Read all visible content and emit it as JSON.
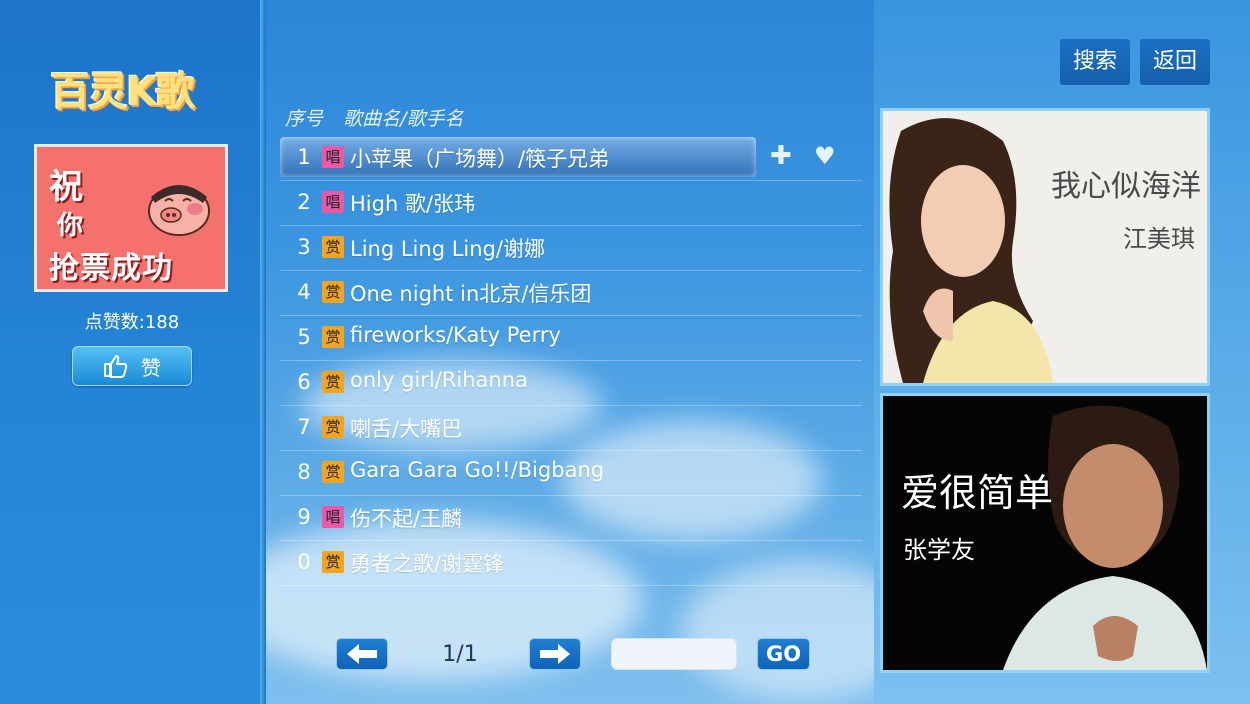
{
  "app": {
    "logo": "百灵K歌"
  },
  "sidebar": {
    "banner_lines": [
      "祝",
      "你",
      "抢票成功"
    ],
    "likes_label": "点赞数:188",
    "like_button": "赞"
  },
  "list": {
    "header_index": "序号",
    "header_title": "歌曲名/歌手名",
    "rows": [
      {
        "num": "1",
        "badge": "唱",
        "type": "sing",
        "title": "小苹果（广场舞）/筷子兄弟"
      },
      {
        "num": "2",
        "badge": "唱",
        "type": "sing",
        "title": "High 歌/张玮"
      },
      {
        "num": "3",
        "badge": "赏",
        "type": "appr",
        "title": "Ling Ling Ling/谢娜"
      },
      {
        "num": "4",
        "badge": "赏",
        "type": "appr",
        "title": "One night in北京/信乐团"
      },
      {
        "num": "5",
        "badge": "赏",
        "type": "appr",
        "title": "fireworks/Katy Perry"
      },
      {
        "num": "6",
        "badge": "赏",
        "type": "appr",
        "title": "only girl/Rihanna"
      },
      {
        "num": "7",
        "badge": "赏",
        "type": "appr",
        "title": "喇舌/大嘴巴"
      },
      {
        "num": "8",
        "badge": "赏",
        "type": "appr",
        "title": "Gara Gara Go!!/Bigbang"
      },
      {
        "num": "9",
        "badge": "唱",
        "type": "sing",
        "title": "伤不起/王麟"
      },
      {
        "num": "0",
        "badge": "赏",
        "type": "appr",
        "title": "勇者之歌/谢霆锋"
      }
    ],
    "add_icon": "plus-icon",
    "fav_icon": "heart-icon"
  },
  "pagination": {
    "page": "1/1",
    "go_label": "GO",
    "input_value": ""
  },
  "right": {
    "search_button": "搜索",
    "back_button": "返回",
    "cards": [
      {
        "title": "我心似海洋",
        "artist": "江美琪"
      },
      {
        "title": "爱很简单",
        "artist": "张学友"
      }
    ]
  },
  "colors": {
    "sing_badge": "#e85aa5",
    "appr_badge": "#f3a51f",
    "button_blue": "#155fae"
  }
}
